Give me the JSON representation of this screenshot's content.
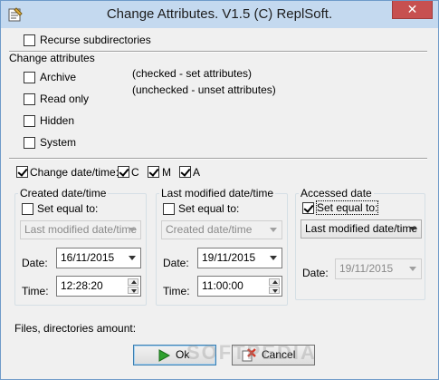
{
  "window": {
    "title": "Change Attributes. V1.5 (C) ReplSoft.",
    "close_label": "✕"
  },
  "options": {
    "recurse_label": "Recurse subdirectories",
    "recurse_checked": false
  },
  "attributes": {
    "group_label": "Change attributes",
    "items": [
      {
        "label": "Archive",
        "checked": false
      },
      {
        "label": "Read only",
        "checked": false
      },
      {
        "label": "Hidden",
        "checked": false
      },
      {
        "label": "System",
        "checked": false
      }
    ],
    "hint_checked": "(checked - set attributes)",
    "hint_unchecked": "(unchecked - unset attributes)"
  },
  "datetime": {
    "change_label": "Change date/time:",
    "change_checked": true,
    "c_label": "C",
    "c_checked": true,
    "m_label": "M",
    "m_checked": true,
    "a_label": "A",
    "a_checked": true
  },
  "created": {
    "group_label": "Created date/time",
    "set_equal_label": "Set equal to:",
    "set_equal_checked": false,
    "source_value": "Last modified date/time",
    "date_label": "Date:",
    "date_value": "16/11/2015",
    "time_label": "Time:",
    "time_value": "12:28:20"
  },
  "modified": {
    "group_label": "Last modified date/time",
    "set_equal_label": "Set equal to:",
    "set_equal_checked": false,
    "source_value": "Created date/time",
    "date_label": "Date:",
    "date_value": "19/11/2015",
    "time_label": "Time:",
    "time_value": "11:00:00"
  },
  "accessed": {
    "group_label": "Accessed date",
    "set_equal_label": "Set equal to:",
    "set_equal_checked": true,
    "source_value": "Last modified date/time",
    "date_label": "Date:",
    "date_value": "19/11/2015"
  },
  "footer": {
    "amount_label": "Files, directories amount:",
    "ok_label": "Ok",
    "cancel_label": "Cancel",
    "watermark": "SOFTPEDIA"
  },
  "colors": {
    "title_bar": "#c4d9ef",
    "close_button": "#c75050",
    "ok_icon": "#2ea12e",
    "cancel_icon": "#d23a2a"
  }
}
